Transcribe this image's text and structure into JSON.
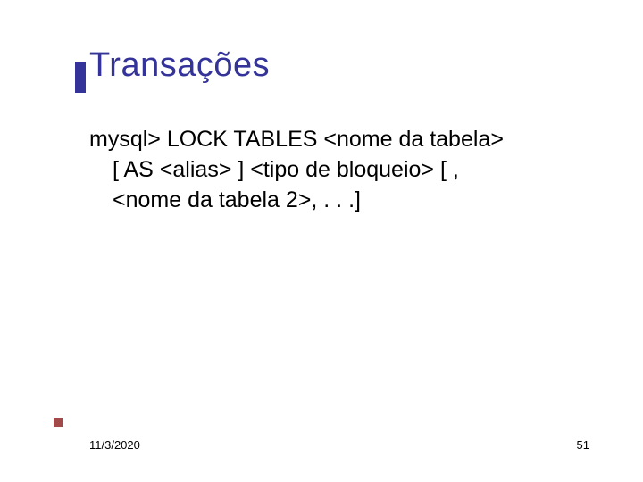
{
  "slide": {
    "title": "Transações",
    "body": {
      "line1": "mysql> LOCK TABLES <nome da tabela>",
      "line2": "[ AS <alias> ] <tipo de bloqueio> [ ,",
      "line3": "<nome da tabela 2>, . . .]"
    },
    "footer": {
      "date": "11/3/2020",
      "page": "51"
    }
  }
}
